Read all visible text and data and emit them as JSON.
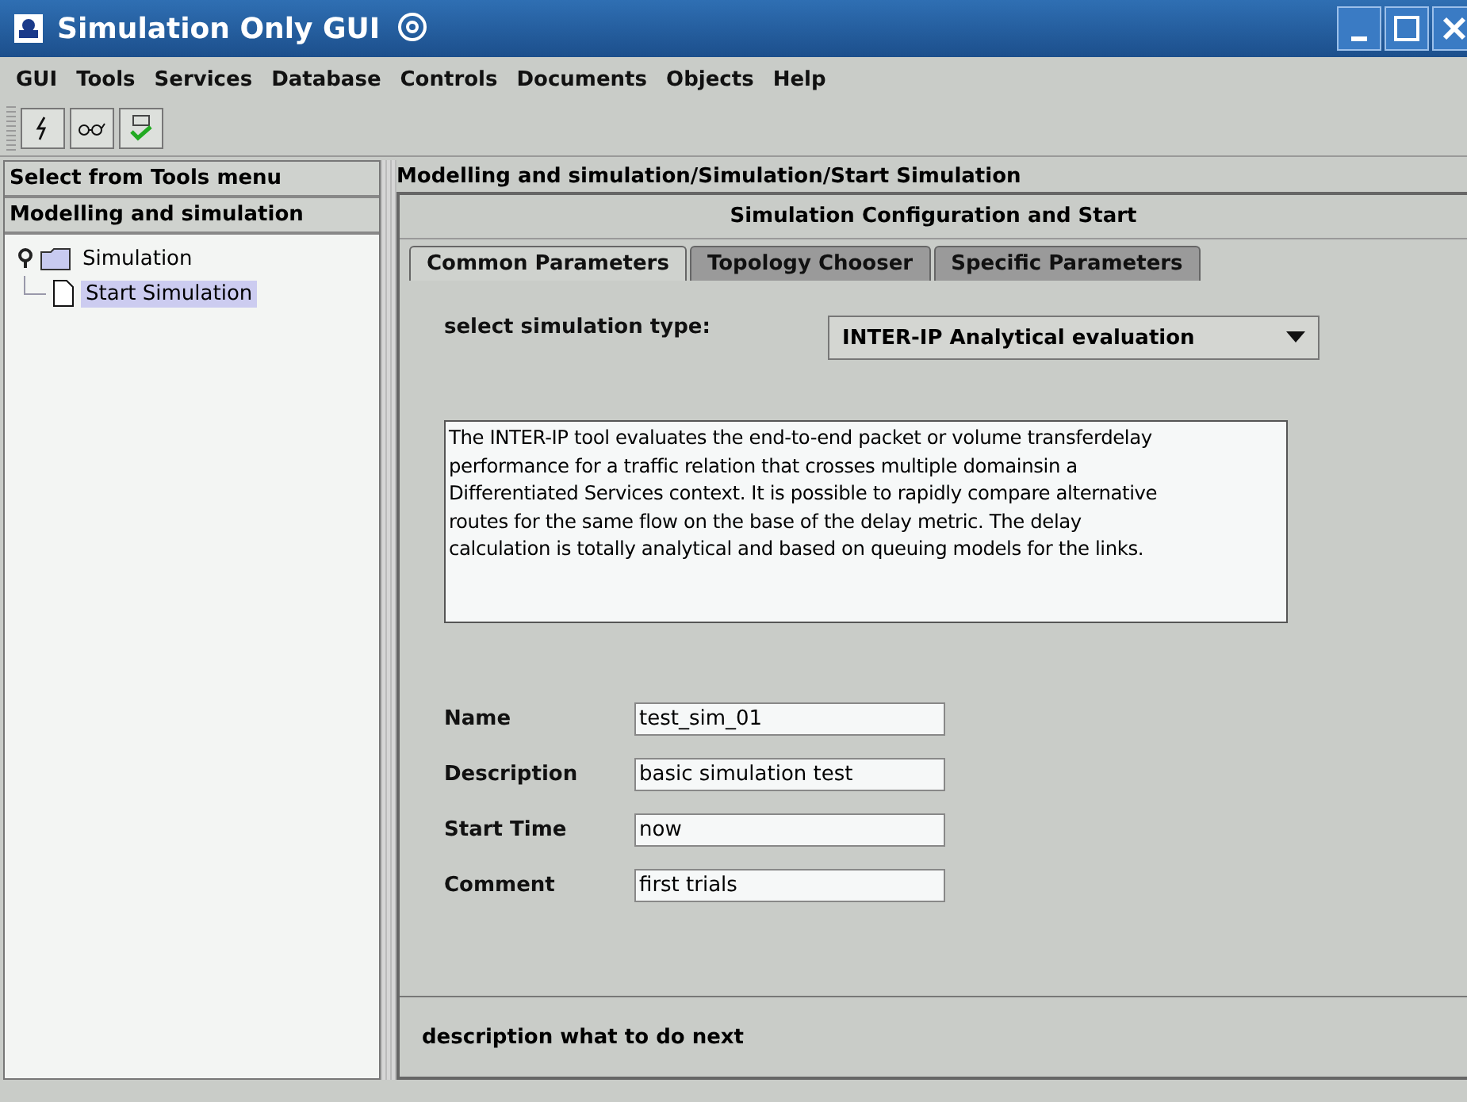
{
  "window": {
    "title": "Simulation Only GUI"
  },
  "menu": [
    "GUI",
    "Tools",
    "Services",
    "Database",
    "Controls",
    "Documents",
    "Objects",
    "Help"
  ],
  "sidebar": {
    "header": "Select from Tools menu",
    "section": "Modelling and simulation",
    "tree": [
      {
        "label": "Simulation",
        "expanded": true,
        "selected": false,
        "children": [
          {
            "label": "Start Simulation",
            "selected": true
          }
        ]
      }
    ]
  },
  "breadcrumb": "Modelling and simulation/Simulation/Start Simulation",
  "panel_title": "Simulation Configuration and Start",
  "tabs": [
    {
      "label": "Common Parameters",
      "selected": true
    },
    {
      "label": "Topology Chooser",
      "selected": false
    },
    {
      "label": "Specific Parameters",
      "selected": false
    }
  ],
  "simulation_type": {
    "label": "select simulation type:",
    "value": "INTER-IP Analytical evaluation"
  },
  "description_lines": [
    "The INTER-IP tool evaluates the end-to-end packet or volume transferdelay",
    "performance for a traffic relation  that crosses multiple domainsin a",
    "Differentiated Services context. It is possible to rapidly compare alternative",
    "routes for the same flow on the base of the delay metric. The delay",
    "calculation is totally analytical and based on queuing models for the links."
  ],
  "fields": [
    {
      "label": "Name",
      "value": "test_sim_01"
    },
    {
      "label": "Description",
      "value": "basic simulation test"
    },
    {
      "label": "Start Time",
      "value": "now"
    },
    {
      "label": "Comment",
      "value": "first trials"
    }
  ],
  "status": "description what to do next"
}
